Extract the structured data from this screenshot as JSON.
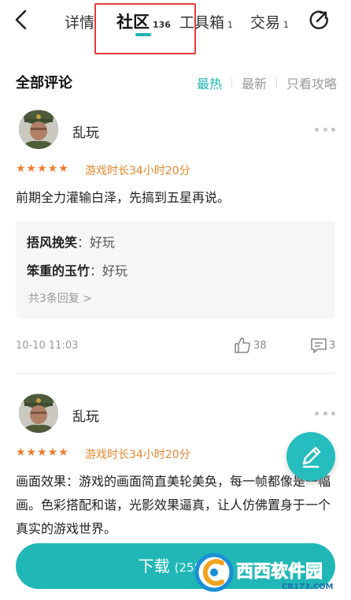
{
  "nav": {
    "tabs": [
      {
        "label": "详情",
        "count": ""
      },
      {
        "label": "社区",
        "count": "136"
      },
      {
        "label": "工具箱",
        "count": "1"
      },
      {
        "label": "交易",
        "count": "1"
      }
    ]
  },
  "section": {
    "title": "全部评论",
    "sort_options": [
      "最热",
      "最新",
      "只看攻略"
    ]
  },
  "comments": [
    {
      "username": "乱玩",
      "stars": "★★★★★",
      "playtime": "游戏时长34小时20分",
      "text": "前期全力灌输白泽，先搞到五星再说。",
      "replies": [
        {
          "author": "捂风挽笑",
          "sep": "：",
          "text": "好玩"
        },
        {
          "author": "笨重的玉竹",
          "sep": "：",
          "text": "好玩"
        }
      ],
      "replies_more": "共3条回复 >",
      "time": "10-10 11:03",
      "likes": "38",
      "reply_count": "3"
    },
    {
      "username": "乱玩",
      "stars": "★★★★★",
      "playtime": "游戏时长34小时20分",
      "text": "画面效果：游戏的画面简直美轮美奂，每一帧都像是一幅画。色彩搭配和谐，光影效果逼真，让人仿佛置身于一个真实的游戏世界。"
    }
  ],
  "download": {
    "label": "下载",
    "size": "(258.1"
  },
  "watermark": {
    "text": "西西软件园",
    "domain": "CR173.COM"
  },
  "colors": {
    "accent": "#1cb3b3",
    "stars": "#f07a2e",
    "highlight_box": "#e23b3b"
  }
}
